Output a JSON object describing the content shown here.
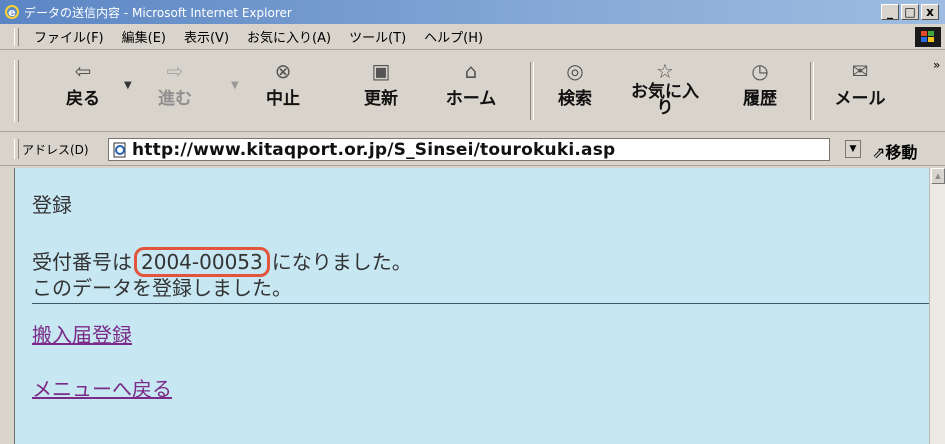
{
  "window": {
    "title": "データの送信内容 - Microsoft Internet Explorer",
    "minimize": "_",
    "maximize": "□",
    "close": "x"
  },
  "menu": [
    "ファイル(F)",
    "編集(E)",
    "表示(V)",
    "お気に入り(A)",
    "ツール(T)",
    "ヘルプ(H)"
  ],
  "toolbar": {
    "back": "戻る",
    "forward": "進む",
    "stop": "中止",
    "refresh": "更新",
    "home": "ホーム",
    "search": "検索",
    "favorites_line1": "お気に入",
    "favorites_line2": "り",
    "history": "履歴",
    "mail": "メール",
    "more": "»"
  },
  "address": {
    "label": "アドレス(D)",
    "url": "http://www.kitaqport.or.jp/S_Sinsei/tourokuki.asp",
    "go": "移動"
  },
  "page": {
    "heading": "登録",
    "receipt_prefix": "受付番号は",
    "receipt_number": "2004-00053",
    "receipt_suffix": "になりました。",
    "registered_message": "このデータを登録しました。",
    "link_register": "搬入届登録",
    "link_menu": "メニューへ戻る"
  }
}
